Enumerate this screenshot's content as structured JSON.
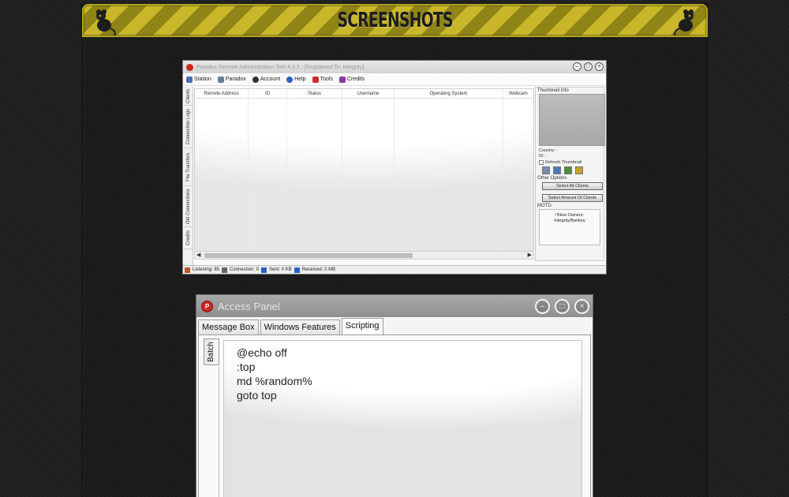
{
  "banner": {
    "title": "SCREENSHOTS"
  },
  "rat_window": {
    "title": "Paradox Remote Administration Tool 4.3.3 .:[Registered To: Integrity]:.",
    "menu": [
      {
        "label": "Station",
        "icon": "station-icon",
        "color": "#4a6fb5"
      },
      {
        "label": "Paradox",
        "icon": "paradox-icon",
        "color": "#6a7d94"
      },
      {
        "label": "Account",
        "icon": "account-icon",
        "color": "#333333"
      },
      {
        "label": "Help",
        "icon": "help-icon",
        "color": "#2b5fc4"
      },
      {
        "label": "Tools",
        "icon": "tools-icon",
        "color": "#c43030"
      },
      {
        "label": "Credits",
        "icon": "credits-icon",
        "color": "#8a3aa0"
      }
    ],
    "side_tabs": [
      "Clients",
      "Connection Logs",
      "File Transfers",
      "Old Connections",
      "Credits"
    ],
    "columns": [
      "Remote Address",
      "ID",
      "Status",
      "Username",
      "Operating System",
      "Webcam"
    ],
    "thumbnail_info": {
      "label": "Thumbnail Info",
      "country": "Country: -",
      "id": "ID: -",
      "refresh": "Refresh Thumbnail"
    },
    "other_options": {
      "label": "Other Options",
      "select_all": "Select All Clients",
      "select_amount": "Select Amount Of Clients"
    },
    "motd": {
      "label": "MOTD",
      "line1": "!!New Owners:",
      "line2": "Integrity/Bankey"
    },
    "status": {
      "listening": "Listening: 85",
      "connection": "Connection: 0",
      "sent": "Sent: 0 KB",
      "received": "Received: 0 MB"
    }
  },
  "access_panel": {
    "title": "Access Panel",
    "tabs": [
      "Message Box",
      "Windows Features",
      "Scripting"
    ],
    "active_tab": "Scripting",
    "vertical_tab": "Batch",
    "script_lines": [
      "@echo off",
      ":top",
      "md %random%",
      "goto top"
    ]
  },
  "colors": {
    "banner_yellow": "#c9b62a",
    "banner_dark": "#8f8416",
    "background": "#1f1f1f",
    "app_red": "#c9281e"
  }
}
